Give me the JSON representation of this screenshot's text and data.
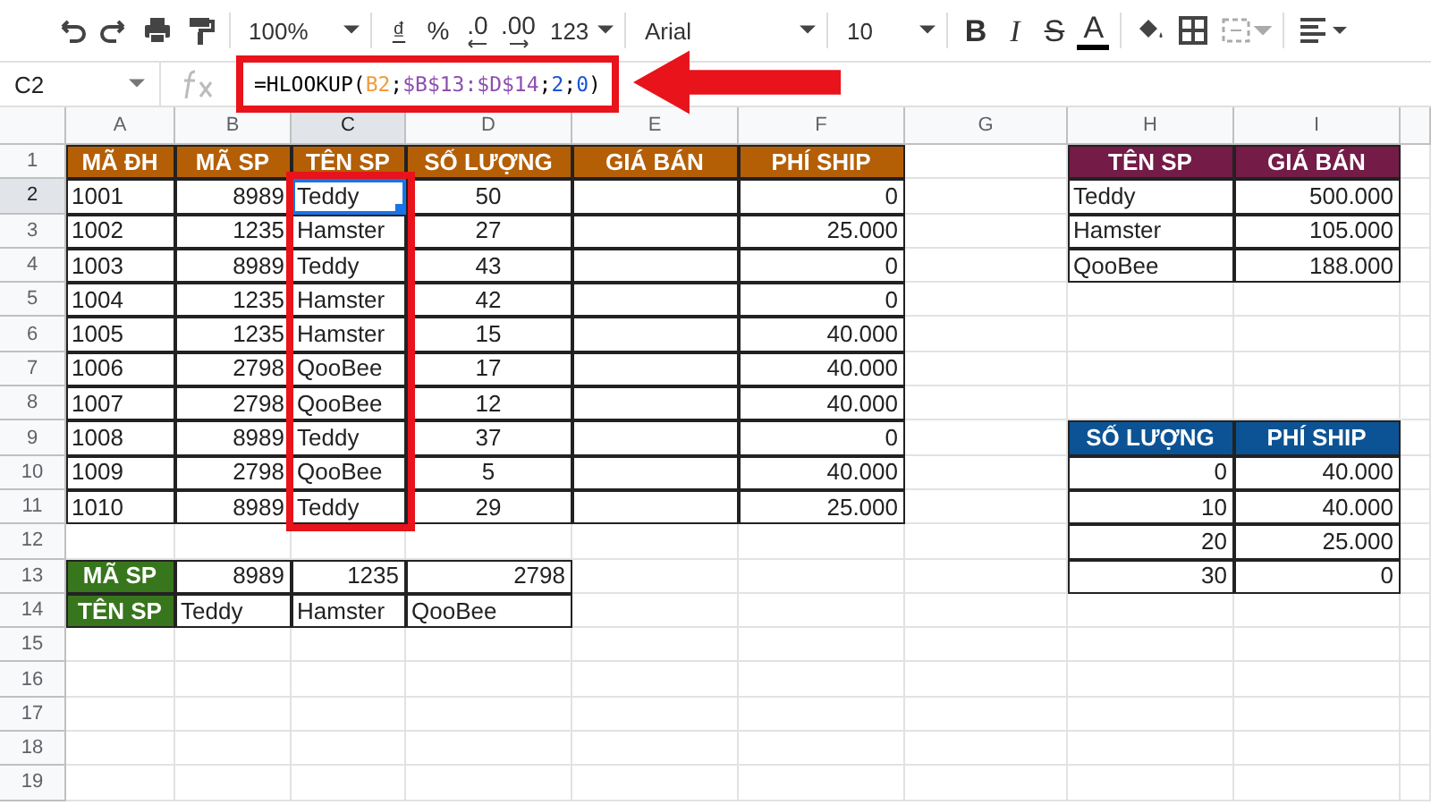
{
  "toolbar": [
    {
      "kind": "undo"
    },
    {
      "kind": "redo"
    },
    {
      "kind": "print"
    },
    {
      "kind": "paint"
    },
    {
      "kind": "sep"
    },
    {
      "kind": "zoom",
      "text": "100%"
    },
    {
      "kind": "sep"
    },
    {
      "kind": "currency",
      "text": "₫"
    },
    {
      "kind": "percent",
      "text": "%"
    },
    {
      "kind": "decrease-decimal",
      "text": ".0"
    },
    {
      "kind": "increase-decimal",
      "text": ".00"
    },
    {
      "kind": "format",
      "text": "123"
    },
    {
      "kind": "sep"
    },
    {
      "kind": "font",
      "text": "Arial"
    },
    {
      "kind": "sep"
    },
    {
      "kind": "size",
      "text": "10"
    },
    {
      "kind": "sep"
    },
    {
      "kind": "bold",
      "text": "B"
    },
    {
      "kind": "italic",
      "text": "I"
    },
    {
      "kind": "strike",
      "text": "S"
    },
    {
      "kind": "textcolor",
      "text": "A"
    },
    {
      "kind": "sep"
    },
    {
      "kind": "fill"
    },
    {
      "kind": "borders"
    },
    {
      "kind": "merge"
    },
    {
      "kind": "sep"
    },
    {
      "kind": "align"
    }
  ],
  "name_box": "C2",
  "formula": [
    {
      "text": "=HLOOKUP(",
      "color": "#000000"
    },
    {
      "text": "B2",
      "color": "#f29b3e"
    },
    {
      "text": ";",
      "color": "#000000"
    },
    {
      "text": "$B$13:$D$14",
      "color": "#8e4fb0"
    },
    {
      "text": ";",
      "color": "#000000"
    },
    {
      "text": "2",
      "color": "#1a55d6"
    },
    {
      "text": ";",
      "color": "#000000"
    },
    {
      "text": "0",
      "color": "#1a55d6"
    },
    {
      "text": ")",
      "color": "#000000"
    }
  ],
  "columns": [
    "A",
    "B",
    "C",
    "D",
    "E",
    "F",
    "G",
    "H",
    "I"
  ],
  "rows": [
    {
      "number": "1",
      "cells": [
        {
          "kind": "header",
          "text": "MÃ ĐH",
          "color": "#b45f06",
          "selected": false
        },
        {
          "kind": "header",
          "text": "MÃ SP",
          "color": "#b45f06",
          "selected": false
        },
        {
          "kind": "header",
          "text": "TÊN SP",
          "color": "#b45f06",
          "selected": false
        },
        {
          "kind": "header",
          "text": "SỐ LƯỢNG",
          "color": "#b45f06",
          "selected": false
        },
        {
          "kind": "header",
          "text": "GIÁ BÁN",
          "color": "#b45f06",
          "selected": false
        },
        {
          "kind": "header",
          "text": "PHÍ SHIP",
          "color": "#b45f06",
          "selected": false
        },
        null,
        {
          "kind": "header",
          "text": "TÊN SP",
          "color": "#741b47",
          "selected": false
        },
        {
          "kind": "header",
          "text": "GIÁ BÁN",
          "color": "#741b47",
          "selected": false
        }
      ]
    },
    {
      "number": "2",
      "cells": [
        {
          "kind": "text",
          "text": "1001",
          "selected": false
        },
        {
          "kind": "number",
          "text": "8989",
          "selected": false
        },
        {
          "kind": "text",
          "text": "Teddy",
          "selected": true
        },
        {
          "kind": "center",
          "text": "50",
          "selected": false
        },
        {
          "kind": "blank",
          "selected": false
        },
        {
          "kind": "number",
          "text": "0",
          "selected": false
        },
        null,
        {
          "kind": "text",
          "text": "Teddy",
          "selected": false
        },
        {
          "kind": "number",
          "text": "500.000",
          "selected": false
        }
      ]
    },
    {
      "number": "3",
      "cells": [
        {
          "kind": "text",
          "text": "1002",
          "selected": false
        },
        {
          "kind": "number",
          "text": "1235",
          "selected": false
        },
        {
          "kind": "text",
          "text": "Hamster",
          "selected": false
        },
        {
          "kind": "center",
          "text": "27",
          "selected": false
        },
        {
          "kind": "blank",
          "selected": false
        },
        {
          "kind": "number",
          "text": "25.000",
          "selected": false
        },
        null,
        {
          "kind": "text",
          "text": "Hamster",
          "selected": false
        },
        {
          "kind": "number",
          "text": "105.000",
          "selected": false
        }
      ]
    },
    {
      "number": "4",
      "cells": [
        {
          "kind": "text",
          "text": "1003",
          "selected": false
        },
        {
          "kind": "number",
          "text": "8989",
          "selected": false
        },
        {
          "kind": "text",
          "text": "Teddy",
          "selected": false
        },
        {
          "kind": "center",
          "text": "43",
          "selected": false
        },
        {
          "kind": "blank",
          "selected": false
        },
        {
          "kind": "number",
          "text": "0",
          "selected": false
        },
        null,
        {
          "kind": "text",
          "text": "QooBee",
          "selected": false
        },
        {
          "kind": "number",
          "text": "188.000",
          "selected": false
        }
      ]
    },
    {
      "number": "5",
      "cells": [
        {
          "kind": "text",
          "text": "1004",
          "selected": false
        },
        {
          "kind": "number",
          "text": "1235",
          "selected": false
        },
        {
          "kind": "text",
          "text": "Hamster",
          "selected": false
        },
        {
          "kind": "center",
          "text": "42",
          "selected": false
        },
        {
          "kind": "blank",
          "selected": false
        },
        {
          "kind": "number",
          "text": "0",
          "selected": false
        },
        null,
        null,
        null
      ]
    },
    {
      "number": "6",
      "cells": [
        {
          "kind": "text",
          "text": "1005",
          "selected": false
        },
        {
          "kind": "number",
          "text": "1235",
          "selected": false
        },
        {
          "kind": "text",
          "text": "Hamster",
          "selected": false
        },
        {
          "kind": "center",
          "text": "15",
          "selected": false
        },
        {
          "kind": "blank",
          "selected": false
        },
        {
          "kind": "number",
          "text": "40.000",
          "selected": false
        },
        null,
        null,
        null
      ]
    },
    {
      "number": "7",
      "cells": [
        {
          "kind": "text",
          "text": "1006",
          "selected": false
        },
        {
          "kind": "number",
          "text": "2798",
          "selected": false
        },
        {
          "kind": "text",
          "text": "QooBee",
          "selected": false
        },
        {
          "kind": "center",
          "text": "17",
          "selected": false
        },
        {
          "kind": "blank",
          "selected": false
        },
        {
          "kind": "number",
          "text": "40.000",
          "selected": false
        },
        null,
        null,
        null
      ]
    },
    {
      "number": "8",
      "cells": [
        {
          "kind": "text",
          "text": "1007",
          "selected": false
        },
        {
          "kind": "number",
          "text": "2798",
          "selected": false
        },
        {
          "kind": "text",
          "text": "QooBee",
          "selected": false
        },
        {
          "kind": "center",
          "text": "12",
          "selected": false
        },
        {
          "kind": "blank",
          "selected": false
        },
        {
          "kind": "number",
          "text": "40.000",
          "selected": false
        },
        null,
        null,
        null
      ]
    },
    {
      "number": "9",
      "cells": [
        {
          "kind": "text",
          "text": "1008",
          "selected": false
        },
        {
          "kind": "number",
          "text": "8989",
          "selected": false
        },
        {
          "kind": "text",
          "text": "Teddy",
          "selected": false
        },
        {
          "kind": "center",
          "text": "37",
          "selected": false
        },
        {
          "kind": "blank",
          "selected": false
        },
        {
          "kind": "number",
          "text": "0",
          "selected": false
        },
        null,
        {
          "kind": "header",
          "text": "SỐ LƯỢNG",
          "color": "#0b5394",
          "selected": false
        },
        {
          "kind": "header",
          "text": "PHÍ SHIP",
          "color": "#0b5394",
          "selected": false
        }
      ]
    },
    {
      "number": "10",
      "cells": [
        {
          "kind": "text",
          "text": "1009",
          "selected": false
        },
        {
          "kind": "number",
          "text": "2798",
          "selected": false
        },
        {
          "kind": "text",
          "text": "QooBee",
          "selected": false
        },
        {
          "kind": "center",
          "text": "5",
          "selected": false
        },
        {
          "kind": "blank",
          "selected": false
        },
        {
          "kind": "number",
          "text": "40.000",
          "selected": false
        },
        null,
        {
          "kind": "number",
          "text": "0",
          "selected": false
        },
        {
          "kind": "number",
          "text": "40.000",
          "selected": false
        }
      ]
    },
    {
      "number": "11",
      "cells": [
        {
          "kind": "text",
          "text": "1010",
          "selected": false
        },
        {
          "kind": "number",
          "text": "8989",
          "selected": false
        },
        {
          "kind": "text",
          "text": "Teddy",
          "selected": false
        },
        {
          "kind": "center",
          "text": "29",
          "selected": false
        },
        {
          "kind": "blank",
          "selected": false
        },
        {
          "kind": "number",
          "text": "25.000",
          "selected": false
        },
        null,
        {
          "kind": "number",
          "text": "10",
          "selected": false
        },
        {
          "kind": "number",
          "text": "40.000",
          "selected": false
        }
      ]
    },
    {
      "number": "12",
      "cells": [
        null,
        null,
        null,
        null,
        null,
        null,
        null,
        {
          "kind": "number",
          "text": "20",
          "selected": false
        },
        {
          "kind": "number",
          "text": "25.000",
          "selected": false
        }
      ]
    },
    {
      "number": "13",
      "cells": [
        {
          "kind": "header",
          "text": "MÃ SP",
          "color": "#38761d",
          "selected": false
        },
        {
          "kind": "number",
          "text": "8989",
          "selected": false
        },
        {
          "kind": "number",
          "text": "1235",
          "selected": false
        },
        {
          "kind": "number",
          "text": "2798",
          "selected": false
        },
        null,
        null,
        null,
        {
          "kind": "number",
          "text": "30",
          "selected": false
        },
        {
          "kind": "number",
          "text": "0",
          "selected": false
        }
      ]
    },
    {
      "number": "14",
      "cells": [
        {
          "kind": "header",
          "text": "TÊN SP",
          "color": "#38761d",
          "selected": false
        },
        {
          "kind": "text",
          "text": "Teddy",
          "selected": false
        },
        {
          "kind": "text",
          "text": "Hamster",
          "selected": false
        },
        {
          "kind": "text",
          "text": "QooBee",
          "selected": false
        },
        null,
        null,
        null,
        null,
        null
      ]
    },
    {
      "number": "15"
    },
    {
      "number": "16"
    },
    {
      "number": "17"
    },
    {
      "number": "18"
    },
    {
      "number": "19"
    }
  ]
}
